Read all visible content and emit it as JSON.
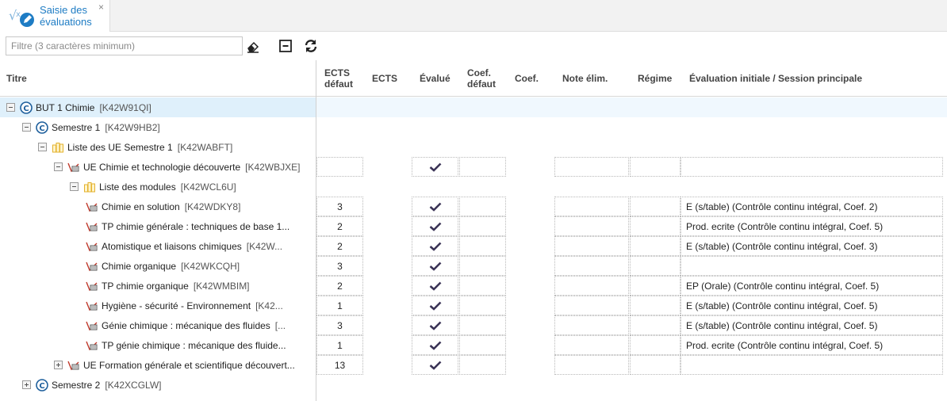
{
  "tab": {
    "title": "Saisie des\névaluations",
    "close": "×",
    "icon": "evaluation-app-icon"
  },
  "toolbar": {
    "filter_placeholder": "Filtre (3 caractères minimum)",
    "filter_value": "",
    "clear_icon": "eraser-icon",
    "collapse_icon": "collapse-all-icon",
    "refresh_icon": "refresh-icon"
  },
  "columns": {
    "titre": "Titre",
    "ects_defaut": "ECTS\ndéfaut",
    "ects": "ECTS",
    "evalue": "Évalué",
    "coef_defaut": "Coef.\ndéfaut",
    "coef": "Coef.",
    "note_elim": "Note élim.",
    "regime": "Régime",
    "evaluation": "Évaluation initiale / Session principale"
  },
  "colors": {
    "accent": "#1e7cc4",
    "check": "#3a3356",
    "folder": "#e3b12b",
    "module": "#c0392b",
    "selected": "#dff0fb"
  },
  "rows": [
    {
      "label": "BUT 1 Chimie",
      "code": "[K42W91QI]",
      "icon": "formation-icon",
      "toggle": "minus"
    },
    {
      "label": "Semestre 1",
      "code": "[K42W9HB2]",
      "icon": "formation-icon",
      "toggle": "minus"
    },
    {
      "label": "Liste des UE Semestre 1",
      "code": "[K42WABFT]",
      "icon": "folder-list-icon",
      "toggle": "minus"
    },
    {
      "label": "UE Chimie et technologie découverte",
      "code": "[K42WBJXE]",
      "icon": "module-icon",
      "toggle": "minus",
      "ects_defaut": "",
      "evalue": true,
      "evaluation": ""
    },
    {
      "label": "Liste des modules",
      "code": "[K42WCL6U]",
      "icon": "folder-list-icon",
      "toggle": "minus"
    },
    {
      "label": "Chimie en solution",
      "code": "[K42WDKY8]",
      "icon": "module-icon",
      "ects_defaut": "3",
      "evalue": true,
      "evaluation": "E (s/table) (Contrôle continu intégral, Coef. 2)"
    },
    {
      "label": "TP chimie générale : techniques de base 1...",
      "code": "",
      "icon": "module-icon",
      "ects_defaut": "2",
      "evalue": true,
      "evaluation": "Prod. ecrite (Contrôle continu intégral, Coef. 5)"
    },
    {
      "label": "Atomistique et liaisons chimiques",
      "code": "[K42W...",
      "icon": "module-icon",
      "ects_defaut": "2",
      "evalue": true,
      "evaluation": "E (s/table) (Contrôle continu intégral, Coef. 3)"
    },
    {
      "label": "Chimie organique",
      "code": "[K42WKCQH]",
      "icon": "module-icon",
      "ects_defaut": "3",
      "evalue": true,
      "evaluation": ""
    },
    {
      "label": "TP chimie organique",
      "code": "[K42WMBIM]",
      "icon": "module-icon",
      "ects_defaut": "2",
      "evalue": true,
      "evaluation": "EP (Orale) (Contrôle continu intégral, Coef. 5)"
    },
    {
      "label": "Hygiène - sécurité - Environnement",
      "code": "[K42...",
      "icon": "module-icon",
      "ects_defaut": "1",
      "evalue": true,
      "evaluation": "E (s/table) (Contrôle continu intégral, Coef. 5)"
    },
    {
      "label": "Génie chimique : mécanique des fluides",
      "code": "[...",
      "icon": "module-icon",
      "ects_defaut": "3",
      "evalue": true,
      "evaluation": "E (s/table) (Contrôle continu intégral, Coef. 5)"
    },
    {
      "label": "TP génie chimique : mécanique des fluide...",
      "code": "",
      "icon": "module-icon",
      "ects_defaut": "1",
      "evalue": true,
      "evaluation": "Prod. ecrite (Contrôle continu intégral, Coef. 5)"
    },
    {
      "label": "UE Formation générale et scientifique découvert...",
      "code": "",
      "icon": "module-icon",
      "toggle": "plus",
      "ects_defaut": "13",
      "evalue": true,
      "evaluation": ""
    },
    {
      "label": "Semestre 2",
      "code": "[K42XCGLW]",
      "icon": "formation-icon",
      "toggle": "plus"
    }
  ]
}
